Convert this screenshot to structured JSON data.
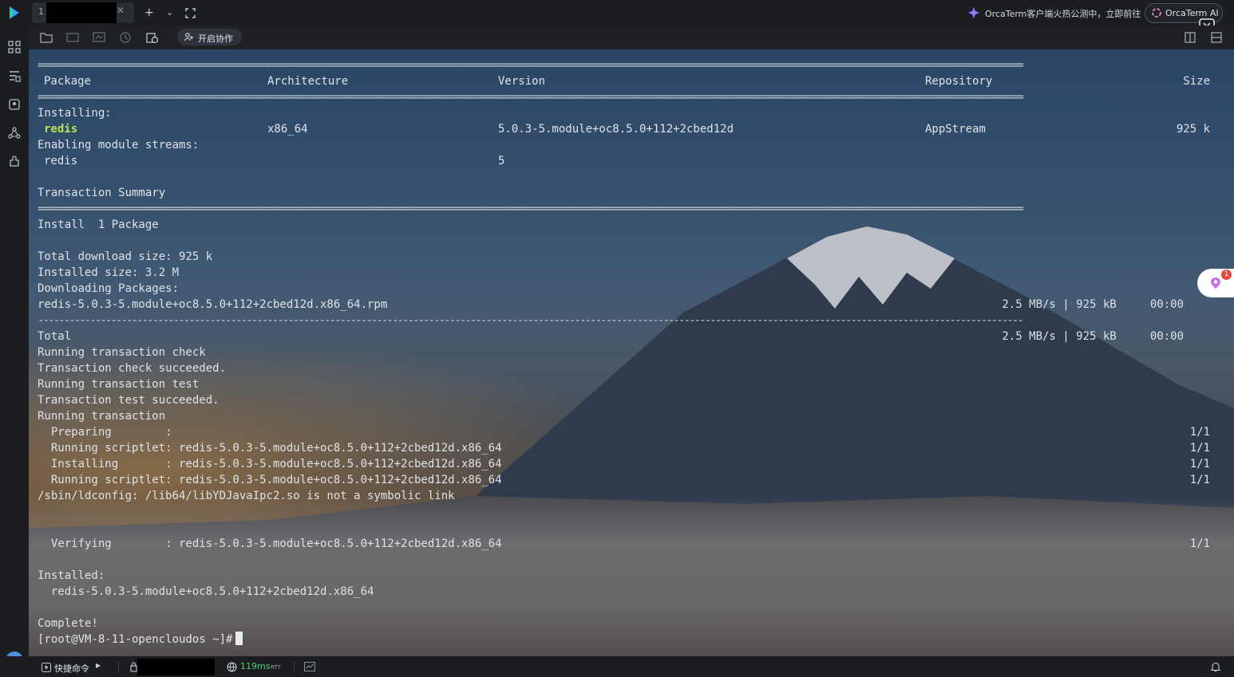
{
  "app": {
    "tab_number": "1",
    "promo_text": "OrcaTerm客户端火热公测中，立即前往",
    "ai_button": "OrcaTerm AI",
    "collab_button": "开启协作",
    "quick_commands": "快捷命令",
    "latency": "119ms",
    "latency_unit": "RTT",
    "notification_count": "1"
  },
  "terminal": {
    "header": {
      "package": "Package",
      "arch": "Architecture",
      "version": "Version",
      "repo": "Repository",
      "size": "Size"
    },
    "installing_label": "Installing:",
    "redis_row": {
      "name": "redis",
      "arch": "x86_64",
      "version": "5.0.3-5.module+oc8.5.0+112+2cbed12d",
      "repo": "AppStream",
      "size": "925 k"
    },
    "module_label": "Enabling module streams:",
    "module_row": {
      "name": "redis",
      "version": "5"
    },
    "summary_label": "Transaction Summary",
    "install_line": "Install  1 Package",
    "download_size": "Total download size: 925 k",
    "installed_size": "Installed size: 3.2 M",
    "downloading": "Downloading Packages:",
    "rpm_file": "redis-5.0.3-5.module+oc8.5.0+112+2cbed12d.x86_64.rpm",
    "rpm_stats": "2.5 MB/s | 925 kB     00:00",
    "total_label": "Total",
    "total_stats": "2.5 MB/s | 925 kB     00:00",
    "run_check": "Running transaction check",
    "check_ok": "Transaction check succeeded.",
    "run_test": "Running transaction test",
    "test_ok": "Transaction test succeeded.",
    "run_tx": "Running transaction",
    "preparing": "  Preparing        :",
    "scriptlet1": "  Running scriptlet: redis-5.0.3-5.module+oc8.5.0+112+2cbed12d.x86_64",
    "installing": "  Installing       : redis-5.0.3-5.module+oc8.5.0+112+2cbed12d.x86_64",
    "scriptlet2": "  Running scriptlet: redis-5.0.3-5.module+oc8.5.0+112+2cbed12d.x86_64",
    "ldconfig": "/sbin/ldconfig: /lib64/libYDJavaIpc2.so is not a symbolic link",
    "verifying": "  Verifying        : redis-5.0.3-5.module+oc8.5.0+112+2cbed12d.x86_64",
    "progress": "1/1",
    "installed_label": "Installed:",
    "installed_pkg": "  redis-5.0.3-5.module+oc8.5.0+112+2cbed12d.x86_64",
    "complete": "Complete!",
    "prompt": "[root@VM-8-11-opencloudos ~]#"
  },
  "rules": {
    "double": "=============================================================================================================================================================================================",
    "single": "---------------------------------------------------------------------------------------------------------------------------------------------------------------------------------------------"
  },
  "colors": {
    "highlight": "#b8e25a",
    "text": "#dfe3e8",
    "accent": "#4bd07a"
  }
}
